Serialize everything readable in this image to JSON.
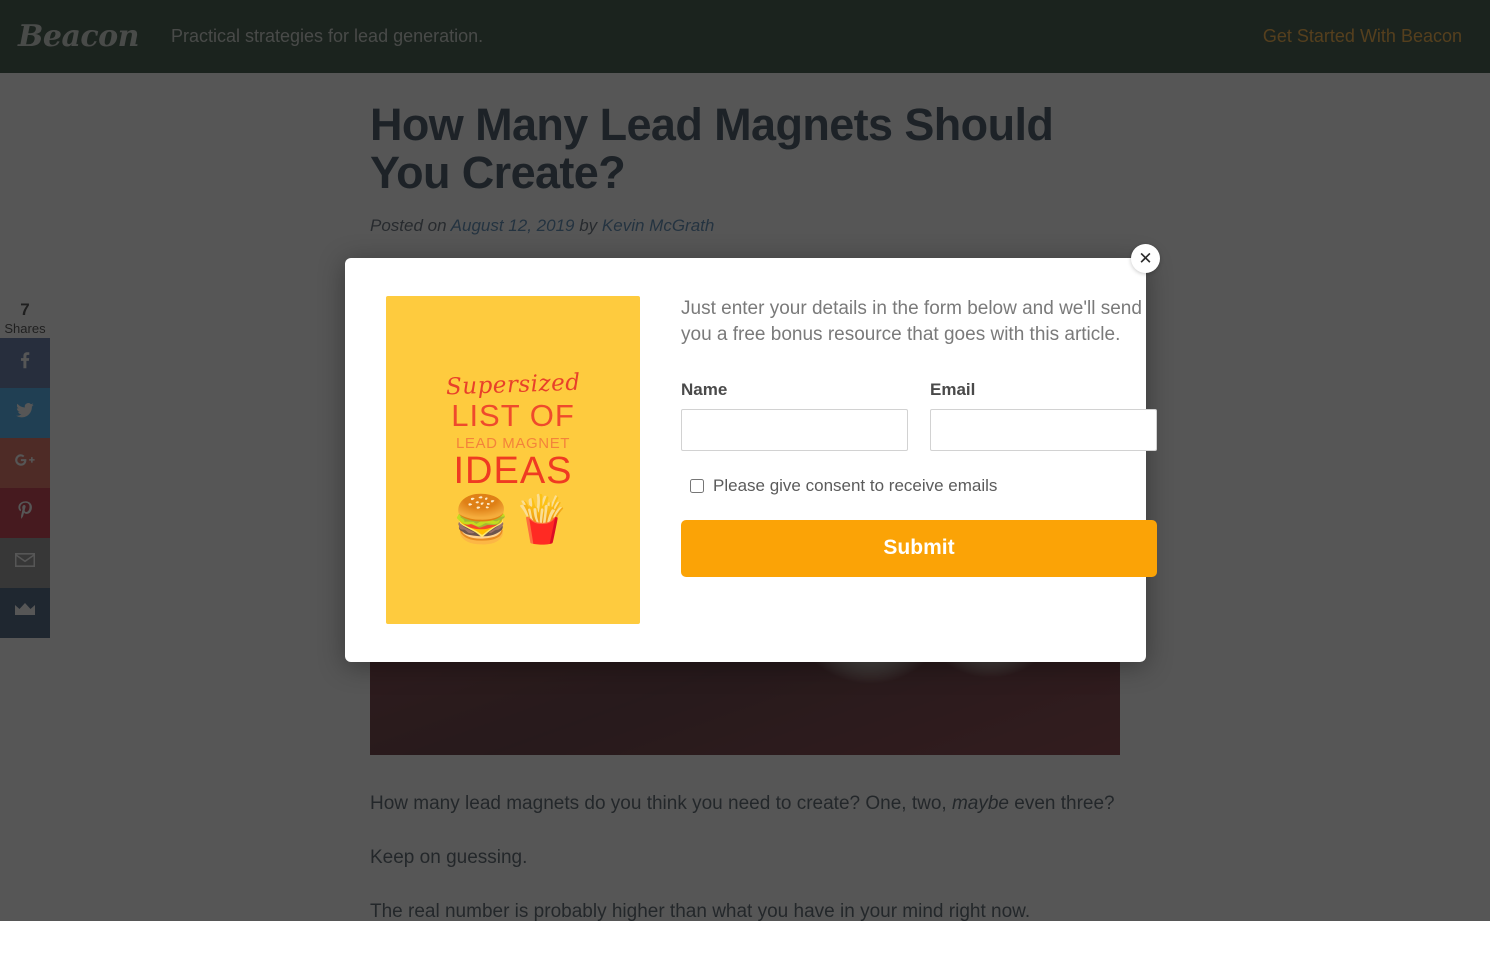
{
  "header": {
    "brand": "Beacon",
    "tagline": "Practical strategies for lead generation.",
    "cta_label": "Get Started With Beacon",
    "background_color": "#0b2a18",
    "cta_color": "#f8a013"
  },
  "article": {
    "title": "How Many Lead Magnets Should You Create?",
    "meta_prefix": "Posted on",
    "date": "August 12, 2019",
    "meta_by": "by",
    "author": "Kevin McGrath",
    "paragraphs": [
      "How many lead magnets do you think you need to create? One, two, maybe even three?",
      "Keep on guessing.",
      "The real number is probably higher than what you have in your mind right now."
    ],
    "paragraph_1_pre": "How many lead magnets do you think you need to create? One, two, ",
    "paragraph_1_em": "maybe",
    "paragraph_1_post": " even three?",
    "paragraph_2": "Keep on guessing.",
    "paragraph_3": "The real number is probably higher than what you have in your mind right now.",
    "hero_alt": "Gift boxes with red ribbons and white bows"
  },
  "share_rail": {
    "count": "7",
    "count_label": "Shares",
    "buttons": [
      {
        "name": "facebook",
        "color": "#3b5998"
      },
      {
        "name": "twitter",
        "color": "#1da1f2"
      },
      {
        "name": "google-plus",
        "color": "#dd4b39",
        "label": "G+"
      },
      {
        "name": "pinterest",
        "color": "#bd081c"
      },
      {
        "name": "email",
        "color": "#7d7d7d"
      },
      {
        "name": "sumome",
        "color": "#1b3a63"
      }
    ]
  },
  "modal": {
    "close_label": "✕",
    "description": "Just enter your details in the form below and we'll send you a free bonus resource that goes with this article.",
    "cover": {
      "line_script": "Supersized",
      "line_big1": "LIST OF",
      "line_small": "LEAD MAGNET",
      "line_big2": "IDEAS",
      "emoji": "🍔🍟",
      "background_color": "#fecb3e",
      "text_color": "#ef3b22"
    },
    "form": {
      "name_label": "Name",
      "name_value": "",
      "name_placeholder": "",
      "email_label": "Email",
      "email_value": "",
      "email_placeholder": "",
      "consent_label": "Please give consent to receive emails",
      "consent_checked": false,
      "submit_label": "Submit",
      "submit_color": "#fba306"
    }
  },
  "overlay": {
    "color": "rgba(33,33,33,0.76)"
  }
}
